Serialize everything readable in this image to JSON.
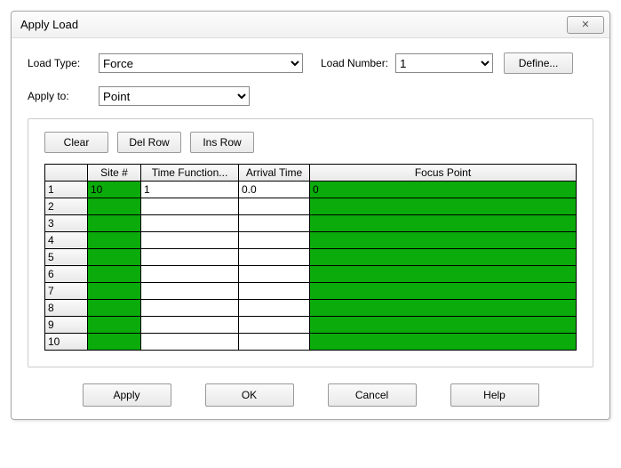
{
  "window": {
    "title": "Apply Load",
    "close_glyph": "✕"
  },
  "form": {
    "load_type_label": "Load Type:",
    "load_type_value": "Force",
    "load_number_label": "Load Number:",
    "load_number_value": "1",
    "define_label": "Define...",
    "apply_to_label": "Apply to:",
    "apply_to_value": "Point"
  },
  "table_buttons": {
    "clear": "Clear",
    "del_row": "Del Row",
    "ins_row": "Ins Row"
  },
  "columns": {
    "site": "Site #",
    "time_function": "Time Function...",
    "arrival_time": "Arrival Time",
    "focus_point": "Focus Point"
  },
  "rows": [
    {
      "n": "1",
      "site": "10",
      "tf": "1",
      "at": "0.0",
      "fp": "0"
    },
    {
      "n": "2",
      "site": "",
      "tf": "",
      "at": "",
      "fp": ""
    },
    {
      "n": "3",
      "site": "",
      "tf": "",
      "at": "",
      "fp": ""
    },
    {
      "n": "4",
      "site": "",
      "tf": "",
      "at": "",
      "fp": ""
    },
    {
      "n": "5",
      "site": "",
      "tf": "",
      "at": "",
      "fp": ""
    },
    {
      "n": "6",
      "site": "",
      "tf": "",
      "at": "",
      "fp": ""
    },
    {
      "n": "7",
      "site": "",
      "tf": "",
      "at": "",
      "fp": ""
    },
    {
      "n": "8",
      "site": "",
      "tf": "",
      "at": "",
      "fp": ""
    },
    {
      "n": "9",
      "site": "",
      "tf": "",
      "at": "",
      "fp": ""
    },
    {
      "n": "10",
      "site": "",
      "tf": "",
      "at": "",
      "fp": ""
    }
  ],
  "footer": {
    "apply": "Apply",
    "ok": "OK",
    "cancel": "Cancel",
    "help": "Help"
  }
}
